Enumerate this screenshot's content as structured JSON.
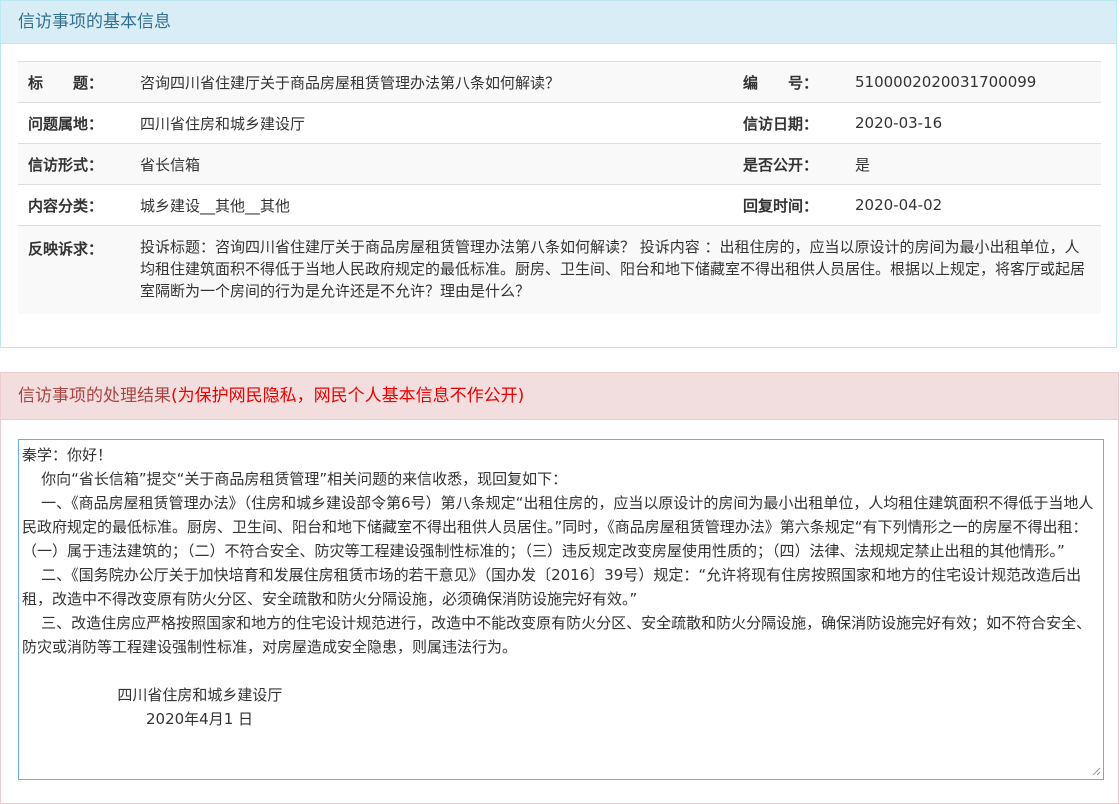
{
  "basic": {
    "heading": "信访事项的基本信息",
    "rows": [
      {
        "l1": "标　　题：",
        "v1": "咨询四川省住建厅关于商品房屋租赁管理办法第八条如何解读？",
        "l2": "编　　号：",
        "v2": "5100002020031700099"
      },
      {
        "l1": "问题属地：",
        "v1": "四川省住房和城乡建设厅",
        "l2": "信访日期：",
        "v2": "2020-03-16"
      },
      {
        "l1": "信访形式：",
        "v1": "省长信箱",
        "l2": "是否公开：",
        "v2": "是"
      },
      {
        "l1": "内容分类：",
        "v1": "城乡建设__其他__其他",
        "l2": "回复时间：",
        "v2": "2020-04-02"
      }
    ],
    "appeal_label": "反映诉求：",
    "appeal_text": "投诉标题：咨询四川省住建厅关于商品房屋租赁管理办法第八条如何解读？ 投诉内容 ：出租住房的，应当以原设计的房间为最小出租单位，人均租住建筑面积不得低于当地人民政府规定的最低标准。厨房、卫生间、阳台和地下储藏室不得出租供人员居住。根据以上规定，将客厅或起居室隔断为一个房间的行为是允许还是不允许？理由是什么？"
  },
  "result": {
    "heading": "信访事项的处理结果",
    "privacy_note": "(为保护网民隐私，网民个人基本信息不作公开)",
    "reply_text": "秦学：你好！\n    你向“省长信箱”提交“关于商品房租赁管理”相关问题的来信收悉，现回复如下：\n    一、《商品房屋租赁管理办法》（住房和城乡建设部令第6号）第八条规定“出租住房的，应当以原设计的房间为最小出租单位，人均租住建筑面积不得低于当地人民政府规定的最低标准。厨房、卫生间、阳台和地下储藏室不得出租供人员居住。”同时，《商品房屋租赁管理办法》第六条规定“有下列情形之一的房屋不得出租：（一）属于违法建筑的；（二）不符合安全、防灾等工程建设强制性标准的；（三）违反规定改变房屋使用性质的；（四）法律、法规规定禁止出租的其他情形。”\n    二、《国务院办公厅关于加快培育和发展住房租赁市场的若干意见》（国办发〔2016〕39号）规定：“允许将现有住房按照国家和地方的住宅设计规范改造后出租，改造中不得改变原有防火分区、安全疏散和防火分隔设施，必须确保消防设施完好有效。”\n    三、改造住房应严格按照国家和地方的住宅设计规范进行，改造中不能改变原有防火分区、安全疏散和防火分隔设施，确保消防设施完好有效；如不符合安全、防灾或消防等工程建设强制性标准，对房屋造成安全隐患，则属违法行为。\n\n                    四川省住房和城乡建设厅\n                          2020年4月1 日"
  }
}
